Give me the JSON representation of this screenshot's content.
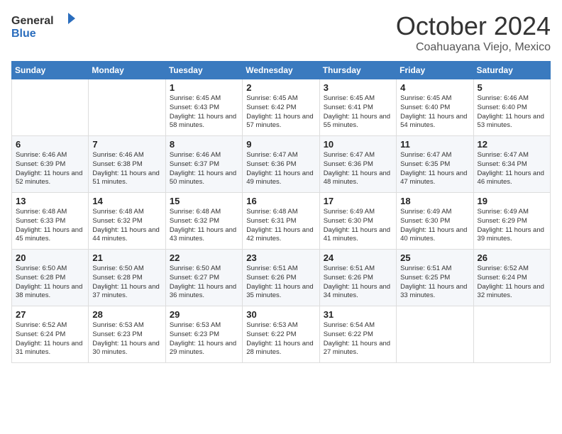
{
  "header": {
    "logo_general": "General",
    "logo_blue": "Blue",
    "month_title": "October 2024",
    "location": "Coahuayana Viejo, Mexico"
  },
  "weekdays": [
    "Sunday",
    "Monday",
    "Tuesday",
    "Wednesday",
    "Thursday",
    "Friday",
    "Saturday"
  ],
  "weeks": [
    [
      {
        "day": "",
        "text": ""
      },
      {
        "day": "",
        "text": ""
      },
      {
        "day": "1",
        "text": "Sunrise: 6:45 AM\nSunset: 6:43 PM\nDaylight: 11 hours and 58 minutes."
      },
      {
        "day": "2",
        "text": "Sunrise: 6:45 AM\nSunset: 6:42 PM\nDaylight: 11 hours and 57 minutes."
      },
      {
        "day": "3",
        "text": "Sunrise: 6:45 AM\nSunset: 6:41 PM\nDaylight: 11 hours and 55 minutes."
      },
      {
        "day": "4",
        "text": "Sunrise: 6:45 AM\nSunset: 6:40 PM\nDaylight: 11 hours and 54 minutes."
      },
      {
        "day": "5",
        "text": "Sunrise: 6:46 AM\nSunset: 6:40 PM\nDaylight: 11 hours and 53 minutes."
      }
    ],
    [
      {
        "day": "6",
        "text": "Sunrise: 6:46 AM\nSunset: 6:39 PM\nDaylight: 11 hours and 52 minutes."
      },
      {
        "day": "7",
        "text": "Sunrise: 6:46 AM\nSunset: 6:38 PM\nDaylight: 11 hours and 51 minutes."
      },
      {
        "day": "8",
        "text": "Sunrise: 6:46 AM\nSunset: 6:37 PM\nDaylight: 11 hours and 50 minutes."
      },
      {
        "day": "9",
        "text": "Sunrise: 6:47 AM\nSunset: 6:36 PM\nDaylight: 11 hours and 49 minutes."
      },
      {
        "day": "10",
        "text": "Sunrise: 6:47 AM\nSunset: 6:36 PM\nDaylight: 11 hours and 48 minutes."
      },
      {
        "day": "11",
        "text": "Sunrise: 6:47 AM\nSunset: 6:35 PM\nDaylight: 11 hours and 47 minutes."
      },
      {
        "day": "12",
        "text": "Sunrise: 6:47 AM\nSunset: 6:34 PM\nDaylight: 11 hours and 46 minutes."
      }
    ],
    [
      {
        "day": "13",
        "text": "Sunrise: 6:48 AM\nSunset: 6:33 PM\nDaylight: 11 hours and 45 minutes."
      },
      {
        "day": "14",
        "text": "Sunrise: 6:48 AM\nSunset: 6:32 PM\nDaylight: 11 hours and 44 minutes."
      },
      {
        "day": "15",
        "text": "Sunrise: 6:48 AM\nSunset: 6:32 PM\nDaylight: 11 hours and 43 minutes."
      },
      {
        "day": "16",
        "text": "Sunrise: 6:48 AM\nSunset: 6:31 PM\nDaylight: 11 hours and 42 minutes."
      },
      {
        "day": "17",
        "text": "Sunrise: 6:49 AM\nSunset: 6:30 PM\nDaylight: 11 hours and 41 minutes."
      },
      {
        "day": "18",
        "text": "Sunrise: 6:49 AM\nSunset: 6:30 PM\nDaylight: 11 hours and 40 minutes."
      },
      {
        "day": "19",
        "text": "Sunrise: 6:49 AM\nSunset: 6:29 PM\nDaylight: 11 hours and 39 minutes."
      }
    ],
    [
      {
        "day": "20",
        "text": "Sunrise: 6:50 AM\nSunset: 6:28 PM\nDaylight: 11 hours and 38 minutes."
      },
      {
        "day": "21",
        "text": "Sunrise: 6:50 AM\nSunset: 6:28 PM\nDaylight: 11 hours and 37 minutes."
      },
      {
        "day": "22",
        "text": "Sunrise: 6:50 AM\nSunset: 6:27 PM\nDaylight: 11 hours and 36 minutes."
      },
      {
        "day": "23",
        "text": "Sunrise: 6:51 AM\nSunset: 6:26 PM\nDaylight: 11 hours and 35 minutes."
      },
      {
        "day": "24",
        "text": "Sunrise: 6:51 AM\nSunset: 6:26 PM\nDaylight: 11 hours and 34 minutes."
      },
      {
        "day": "25",
        "text": "Sunrise: 6:51 AM\nSunset: 6:25 PM\nDaylight: 11 hours and 33 minutes."
      },
      {
        "day": "26",
        "text": "Sunrise: 6:52 AM\nSunset: 6:24 PM\nDaylight: 11 hours and 32 minutes."
      }
    ],
    [
      {
        "day": "27",
        "text": "Sunrise: 6:52 AM\nSunset: 6:24 PM\nDaylight: 11 hours and 31 minutes."
      },
      {
        "day": "28",
        "text": "Sunrise: 6:53 AM\nSunset: 6:23 PM\nDaylight: 11 hours and 30 minutes."
      },
      {
        "day": "29",
        "text": "Sunrise: 6:53 AM\nSunset: 6:23 PM\nDaylight: 11 hours and 29 minutes."
      },
      {
        "day": "30",
        "text": "Sunrise: 6:53 AM\nSunset: 6:22 PM\nDaylight: 11 hours and 28 minutes."
      },
      {
        "day": "31",
        "text": "Sunrise: 6:54 AM\nSunset: 6:22 PM\nDaylight: 11 hours and 27 minutes."
      },
      {
        "day": "",
        "text": ""
      },
      {
        "day": "",
        "text": ""
      }
    ]
  ]
}
